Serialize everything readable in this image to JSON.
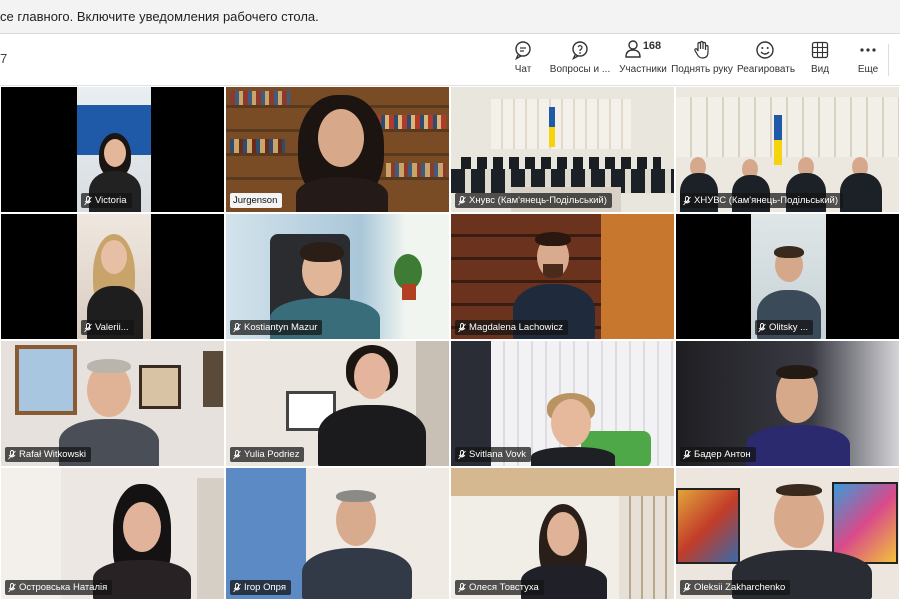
{
  "notice": {
    "text": "се главного. Включите уведомления рабочего стола."
  },
  "toolbar": {
    "meeting_id_fragment": "7",
    "chat": {
      "label": "Чат",
      "icon": "chat-icon"
    },
    "questions": {
      "label": "Вопросы и ...",
      "icon": "question-icon"
    },
    "participants": {
      "label": "Участники",
      "count": "168",
      "icon": "people-icon"
    },
    "raise_hand": {
      "label": "Поднять руку",
      "icon": "hand-icon"
    },
    "react": {
      "label": "Реагировать",
      "icon": "smile-icon"
    },
    "view": {
      "label": "Вид",
      "icon": "grid-view-icon"
    },
    "more": {
      "label": "Еще",
      "icon": "more-icon"
    }
  },
  "participants": [
    {
      "name": "Victoria"
    },
    {
      "name": "Jurgenson"
    },
    {
      "name": "Хнувс (Кам'янець-Подільський)"
    },
    {
      "name": "ХНУВС (Кам'янець-Подільський)"
    },
    {
      "name": "Valerii..."
    },
    {
      "name": "Kostiantyn Mazur"
    },
    {
      "name": "Magdalena Lachowicz"
    },
    {
      "name": "Olitsky ..."
    },
    {
      "name": "Rafał Witkowski"
    },
    {
      "name": "Yulia Podriez"
    },
    {
      "name": "Svitlana Vovk"
    },
    {
      "name": "Бадер Антон"
    },
    {
      "name": "Островська Наталія"
    },
    {
      "name": "Ігор Опря"
    },
    {
      "name": "Олеся Товстуха"
    },
    {
      "name": "Oleksii Zakharchenko"
    }
  ],
  "colors": {
    "toolbar_bg": "#ffffff",
    "notice_bg": "#f3f3f3",
    "grid_bg": "#1b1b1b"
  }
}
